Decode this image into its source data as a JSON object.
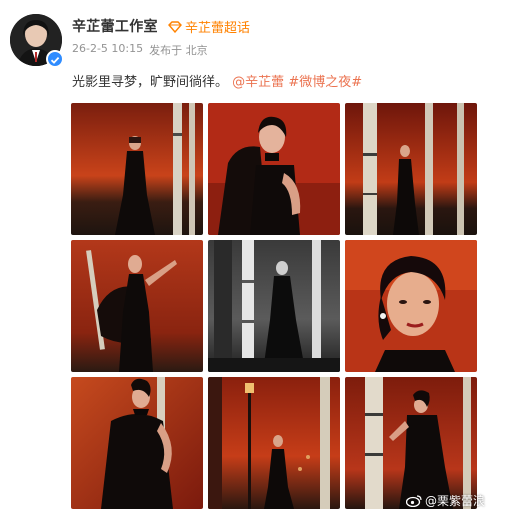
{
  "author": {
    "name": "辛芷蕾工作室",
    "supertopic": "辛芷蕾超话"
  },
  "meta": {
    "date": "26-2-5 10:15",
    "location": "发布于 北京"
  },
  "post": {
    "text": "光影里寻梦，旷野间徜徉。",
    "mention": "@辛芷蕾",
    "hashtag": "#微博之夜#"
  },
  "watermark": "@栗紫蕾浪",
  "photos": [
    {
      "scene": "sunset-birch-standing-gown"
    },
    {
      "scene": "red-backdrop-closeup-jacket"
    },
    {
      "scene": "birch-trees-sunset-wide"
    },
    {
      "scene": "red-sky-arms-raised"
    },
    {
      "scene": "monochrome-birch-forest"
    },
    {
      "scene": "red-closeup-portrait"
    },
    {
      "scene": "red-backdrop-strapless-gown"
    },
    {
      "scene": "streetlamp-red-sky"
    },
    {
      "scene": "birch-trees-leaning"
    }
  ],
  "colors": {
    "link": "#eb7350",
    "supertopic": "#ff8200",
    "verified": "#2f8cff",
    "meta": "#939393"
  }
}
